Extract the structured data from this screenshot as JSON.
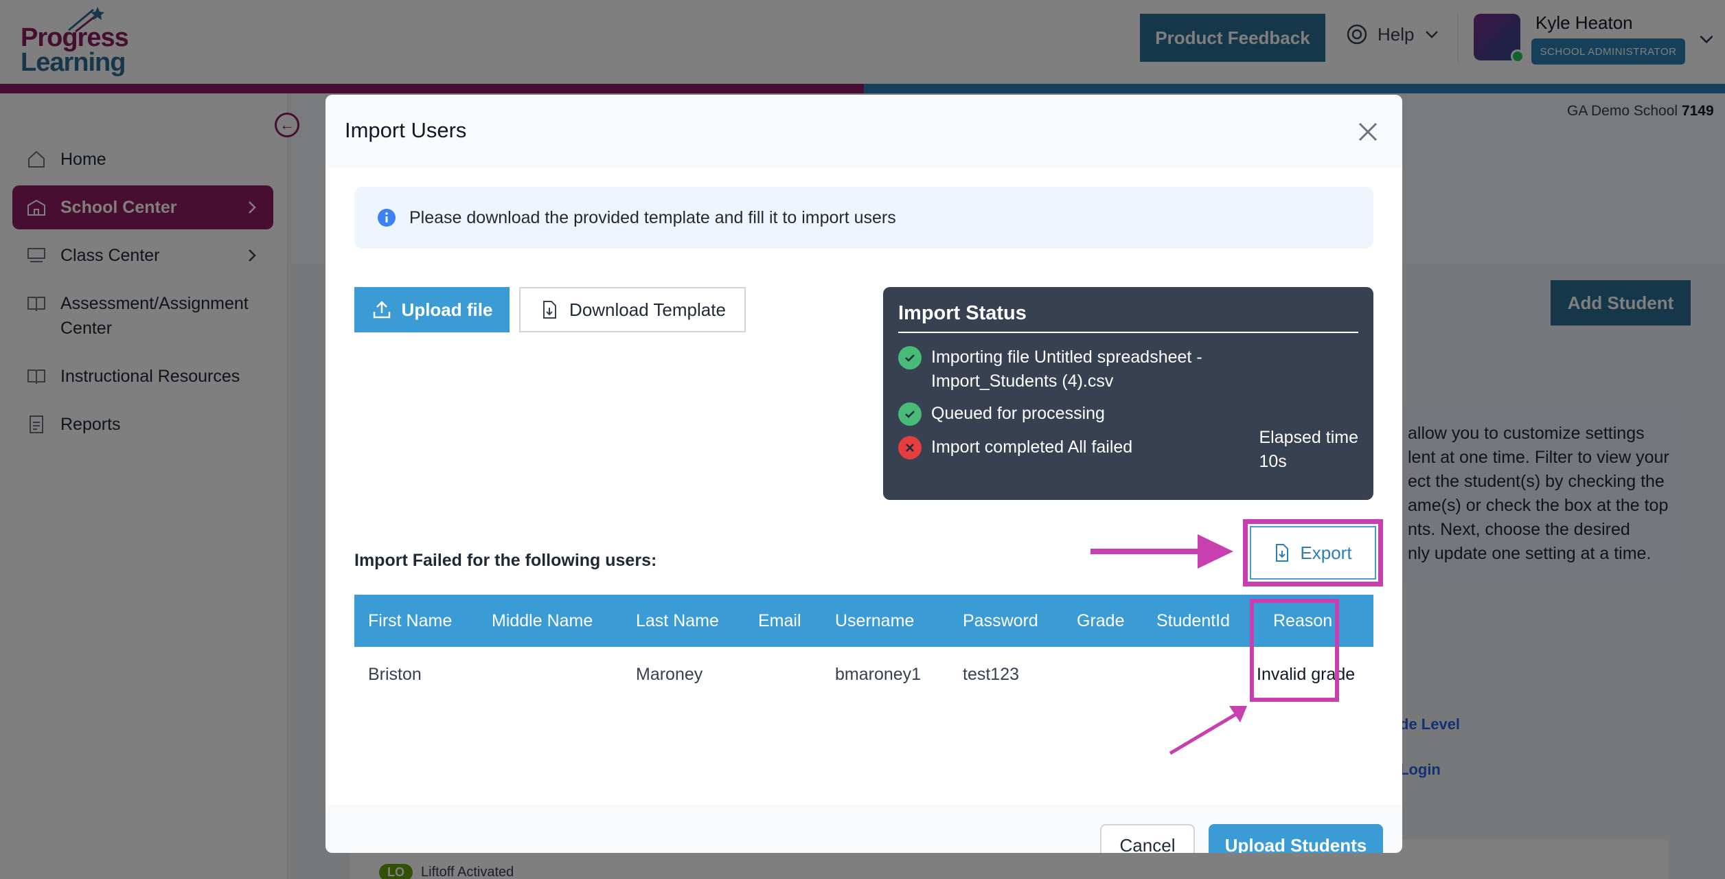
{
  "colors": {
    "brand_magenta": "#8e1c62",
    "brand_blue": "#2d7fb3",
    "header_blue": "#2b6f93",
    "table_header": "#3a9bd5",
    "annotation": "#c83fb0",
    "status_bg": "#374151"
  },
  "header": {
    "logo_line1": "Progress",
    "logo_line2": "Learning",
    "feedback_label": "Product Feedback",
    "help_label": "Help",
    "user_name": "Kyle Heaton",
    "user_role": "SCHOOL ADMINISTRATOR"
  },
  "sidebar": {
    "items": [
      {
        "label": "Home",
        "icon": "home-icon"
      },
      {
        "label": "School Center",
        "icon": "school-icon"
      },
      {
        "label": "Class Center",
        "icon": "classroom-icon"
      },
      {
        "label": "Assessment/Assignment Center",
        "icon": "book-icon"
      },
      {
        "label": "Instructional Resources",
        "icon": "resources-icon"
      },
      {
        "label": "Reports",
        "icon": "report-icon"
      }
    ]
  },
  "background": {
    "school_name": "GA Demo School",
    "school_id": "7149",
    "add_student_label": "Add Student",
    "info_text": "allow you to customize settings\nlent at one time. Filter to view your\nect the student(s) by checking the\name(s) or check the box at the top\nnts. Next, choose the desired\nnly update one setting at a time.",
    "link_a": "de Level",
    "link_b": "Login",
    "liftoff_badge": "LO",
    "liftoff_label": "Liftoff Activated"
  },
  "modal": {
    "title": "Import Users",
    "notice": "Please download the provided template and fill it to import users",
    "upload_label": "Upload file",
    "download_label": "Download Template",
    "status": {
      "title": "Import Status",
      "steps": [
        {
          "text": "Importing file Untitled spreadsheet - Import_Students (4).csv",
          "state": "success"
        },
        {
          "text": "Queued for processing",
          "state": "success"
        },
        {
          "text": "Import completed All failed",
          "state": "error"
        }
      ],
      "elapsed_label": "Elapsed time",
      "elapsed_value": "10s"
    },
    "fail_label": "Import Failed for the following users:",
    "export_label": "Export",
    "table": {
      "columns": [
        "First Name",
        "Middle Name",
        "Last Name",
        "Email",
        "Username",
        "Password",
        "Grade",
        "StudentId",
        "Reason"
      ],
      "rows": [
        [
          "Briston",
          "",
          "Maroney",
          "",
          "bmaroney1",
          "test123",
          "",
          "",
          "Invalid grade"
        ]
      ]
    },
    "cancel_label": "Cancel",
    "submit_label": "Upload Students"
  }
}
